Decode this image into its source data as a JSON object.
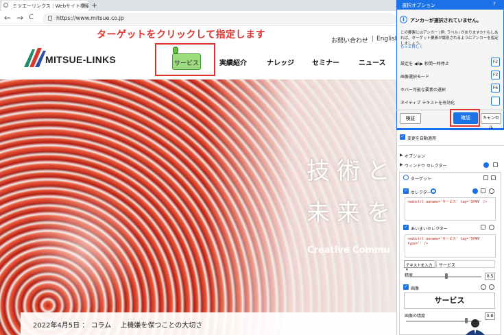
{
  "browser": {
    "tab_title": "ミツエーリンクス｜Webサイト構築・運",
    "tab_close": "×",
    "new_tab": "+",
    "nav_back": "←",
    "nav_forward": "→",
    "nav_reload": "C",
    "url": "https://www.mitsue.co.jp"
  },
  "page": {
    "instruction": "ターゲットをクリックして指定します",
    "top_links": {
      "contact": "お問い合わせ",
      "separator": "|",
      "english": "English"
    },
    "logo": "MITSUE-LINKS",
    "nav": [
      "サービス",
      "実績紹介",
      "ナレッジ",
      "セミナー",
      "ニュース"
    ],
    "hero": {
      "copy_line1": "技術と",
      "copy_line2": "未来を",
      "subcopy": "Creative Commu"
    },
    "news": "2022年4月5日 ： コラム　 上機嫌を保つことの大切さ"
  },
  "dialog": {
    "title": "選択オプション",
    "help": "?",
    "info_icon": "i",
    "warning": "アンカーが選択されていません。",
    "description": "この要素にはアンカー (例: ラベル) がありますか? もしあれば、ターゲット要素が識別されるようにアンカーを指定しましょう。",
    "more_link": "もっと詳しく",
    "rows": [
      {
        "label": "設定を  ◀5▶  秒間一時停止",
        "key": "F2"
      },
      {
        "label": "画像選択モード",
        "key": "F3"
      },
      {
        "label": "ホバー可能な要素の選択",
        "key": "F6"
      },
      {
        "label": "ネイティブ テキストを有効化",
        "key": ""
      }
    ],
    "verify": "検証",
    "confirm": "確認",
    "cancel": "キャンセル"
  },
  "panel": {
    "auto_apply": "変更を自動適用",
    "options": "オプション",
    "window_selector": "ウィンドウ セレクター",
    "target": "ターゲット",
    "selector_label": "セレクター",
    "selector_code": "<webctrl aaname='サービス' tag='SPAN' />",
    "fuzzy_label": "あいまいセレクター",
    "fuzzy_code": "<webctrl aaname='サービス' tag='SPAN' type='' />",
    "text_input_mode": "テキストを入力 ▾",
    "text_input_value": "サービス",
    "precision_label": "精度",
    "precision_value": "0.5",
    "precision_fraction": 0.5,
    "image_label": "画像",
    "image_preview": "サービス",
    "image_precision_label": "画像の精度",
    "image_precision_value": "0.8",
    "image_precision_fraction": 0.8
  },
  "colors": {
    "accent": "#1b72e8",
    "annotation": "#e0322d",
    "highlight": "#9ddb7f"
  }
}
